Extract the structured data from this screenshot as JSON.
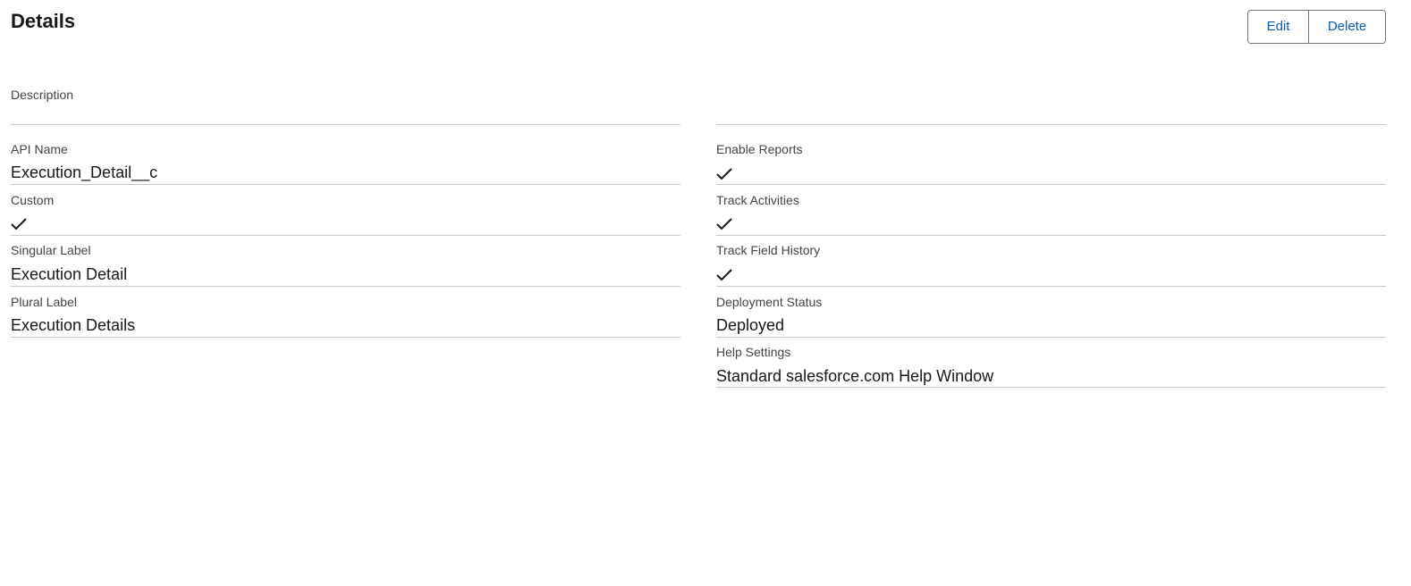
{
  "header": {
    "title": "Details",
    "edit_label": "Edit",
    "delete_label": "Delete"
  },
  "fields": {
    "description": {
      "label": "Description",
      "value": ""
    },
    "api_name": {
      "label": "API Name",
      "value": "Execution_Detail__c"
    },
    "custom": {
      "label": "Custom",
      "checked": true,
      "icon": "checkmark-icon"
    },
    "singular_label": {
      "label": "Singular Label",
      "value": "Execution Detail"
    },
    "plural_label": {
      "label": "Plural Label",
      "value": "Execution Details"
    },
    "enable_reports": {
      "label": "Enable Reports",
      "checked": true,
      "icon": "checkmark-icon"
    },
    "track_activities": {
      "label": "Track Activities",
      "checked": true,
      "icon": "checkmark-icon"
    },
    "track_field_history": {
      "label": "Track Field History",
      "checked": true,
      "icon": "checkmark-icon"
    },
    "deployment_status": {
      "label": "Deployment Status",
      "value": "Deployed"
    },
    "help_settings": {
      "label": "Help Settings",
      "value": "Standard salesforce.com Help Window"
    }
  },
  "colors": {
    "link": "#0b5cab",
    "border": "#747474",
    "divider": "#c9c9c9"
  }
}
